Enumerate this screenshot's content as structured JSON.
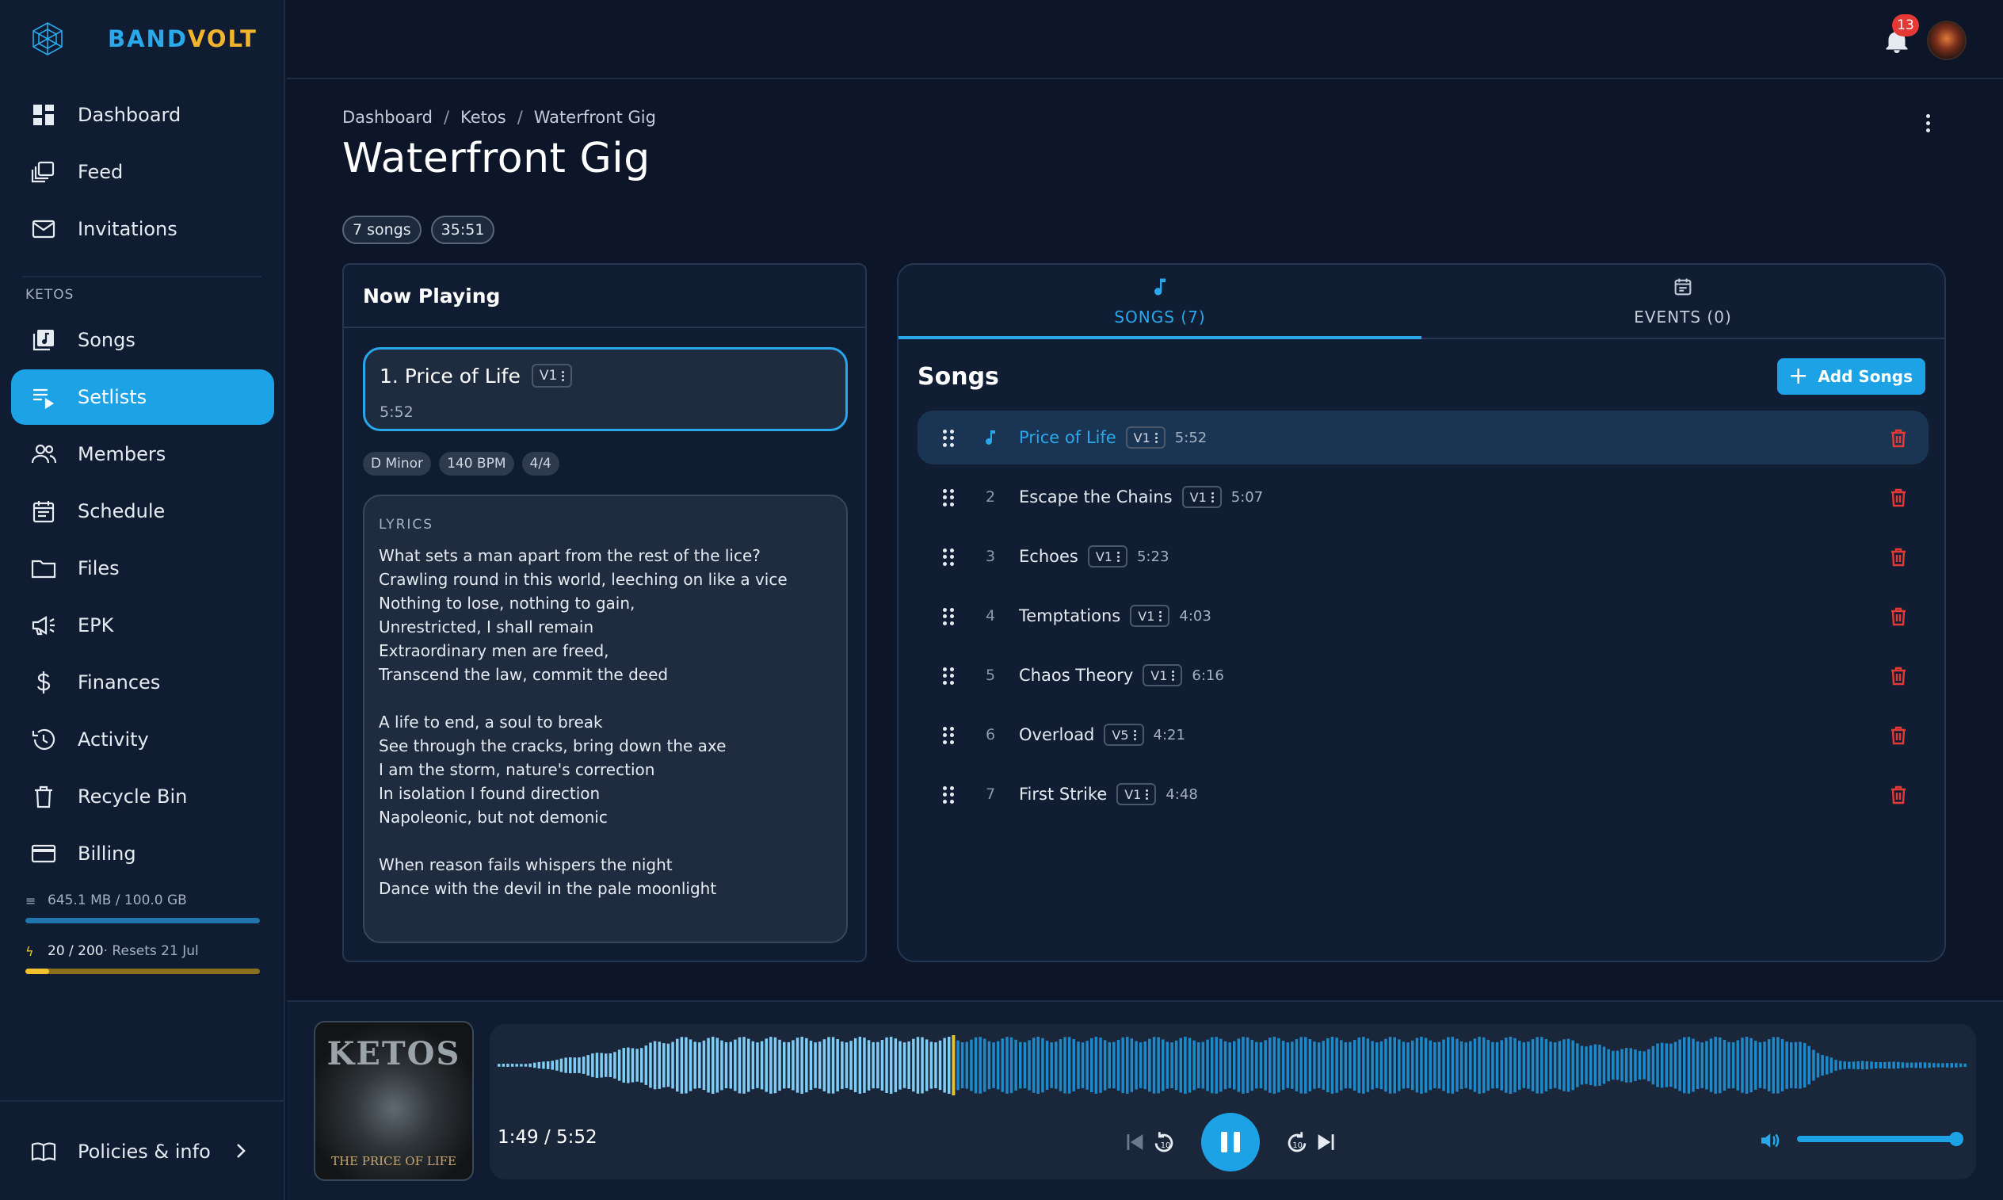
{
  "brand": {
    "part1": "BAND",
    "part2": "VOLT"
  },
  "nav_top": [
    {
      "label": "Dashboard",
      "icon": "dashboard-icon"
    },
    {
      "label": "Feed",
      "icon": "feed-icon"
    },
    {
      "label": "Invitations",
      "icon": "mail-icon"
    }
  ],
  "section_label": "KETOS",
  "nav_band": [
    {
      "label": "Songs",
      "icon": "music-library-icon"
    },
    {
      "label": "Setlists",
      "icon": "playlist-icon",
      "active": true
    },
    {
      "label": "Members",
      "icon": "people-icon"
    },
    {
      "label": "Schedule",
      "icon": "calendar-icon"
    },
    {
      "label": "Files",
      "icon": "folder-icon"
    },
    {
      "label": "EPK",
      "icon": "megaphone-icon"
    },
    {
      "label": "Finances",
      "icon": "dollar-icon"
    },
    {
      "label": "Activity",
      "icon": "history-icon"
    },
    {
      "label": "Recycle Bin",
      "icon": "trash-icon"
    },
    {
      "label": "Billing",
      "icon": "credit-card-icon"
    }
  ],
  "usage": {
    "storage_label": "645.1 MB / 100.0 GB",
    "storage_fraction": 0.0065,
    "storage_color": "#1ea2e6",
    "credits_count": "20 / 200",
    "credits_reset": " · Resets 21 Jul",
    "credits_fraction": 0.1,
    "credits_color": "#f2c12e"
  },
  "policies_label": "Policies & info",
  "topbar": {
    "notification_count": "13"
  },
  "breadcrumb": [
    "Dashboard",
    "Ketos",
    "Waterfront Gig"
  ],
  "page_title": "Waterfront Gig",
  "chips": [
    "7 songs",
    "35:51"
  ],
  "now_playing": {
    "header": "Now Playing",
    "song_title": "1. Price of Life",
    "version": "V1",
    "duration": "5:52",
    "tags": [
      "D Minor",
      "140 BPM",
      "4/4"
    ],
    "lyrics_label": "LYRICS",
    "lyrics": [
      "What sets a man apart from the rest of the lice?",
      "Crawling round in this world, leeching on like a vice",
      "Nothing to lose, nothing to gain,",
      "Unrestricted, I shall remain",
      "Extraordinary men are freed,",
      "Transcend the law, commit the deed",
      "",
      "A life to end, a soul to break",
      "See through the cracks, bring down the axe",
      "I am the storm, nature's correction",
      "In isolation I found direction",
      "Napoleonic, but not demonic",
      "",
      "When reason fails whispers the night",
      "Dance with the devil in the pale moonlight"
    ]
  },
  "tabs": {
    "songs": "SONGS (7)",
    "events": "EVENTS (0)"
  },
  "songs_panel": {
    "title": "Songs",
    "add_label": "Add Songs",
    "songs": [
      {
        "num": "1",
        "name": "Price of Life",
        "version": "V1",
        "duration": "5:52",
        "active": true
      },
      {
        "num": "2",
        "name": "Escape the Chains",
        "version": "V1",
        "duration": "5:07"
      },
      {
        "num": "3",
        "name": "Echoes",
        "version": "V1",
        "duration": "5:23"
      },
      {
        "num": "4",
        "name": "Temptations",
        "version": "V1",
        "duration": "4:03"
      },
      {
        "num": "5",
        "name": "Chaos Theory",
        "version": "V1",
        "duration": "6:16"
      },
      {
        "num": "6",
        "name": "Overload",
        "version": "V5",
        "duration": "4:21"
      },
      {
        "num": "7",
        "name": "First Strike",
        "version": "V1",
        "duration": "4:48"
      }
    ]
  },
  "player": {
    "current_time": "1:49",
    "total_time": "5:52",
    "progress_fraction": 0.31,
    "volume_fraction": 1.0,
    "cover_title": "THE PRICE OF LIFE",
    "cover_logo": "KETOS",
    "colors": {
      "played": "#7fcdf5",
      "unplayed": "#1e88c8",
      "marker": "#e0c23a",
      "accent": "#1ea2e6"
    }
  }
}
